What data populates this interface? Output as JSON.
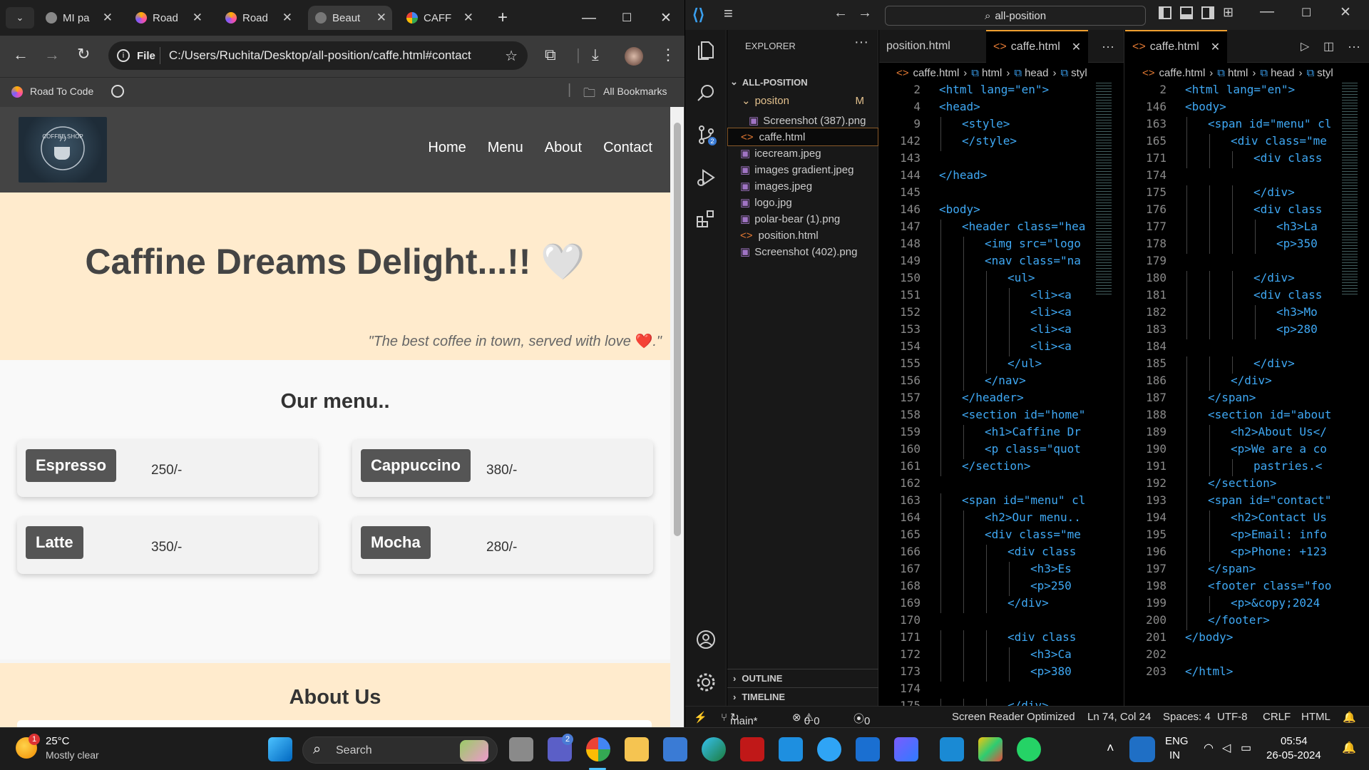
{
  "browser": {
    "tabs": [
      {
        "label": "MI pa"
      },
      {
        "label": "Road"
      },
      {
        "label": "Road"
      },
      {
        "label": "Beaut"
      },
      {
        "label": "CAFF"
      }
    ],
    "url": "C:/Users/Ruchita/Desktop/all-position/caffe.html#contact",
    "url_scheme_label": "File",
    "bookmarks": [
      {
        "label": "Road To Code"
      }
    ],
    "all_bookmarks": "All Bookmarks"
  },
  "site": {
    "nav": [
      "Home",
      "Menu",
      "About",
      "Contact"
    ],
    "hero_title": "Caffine Dreams Delight...!!",
    "heart": "🤍",
    "quote_a": "\"The best coffee in town, served with love ",
    "quote_heart": "❤️",
    "quote_b": ".\"",
    "menu_title": "Our menu..",
    "menu_items": [
      {
        "name": "Espresso",
        "price": "250/-"
      },
      {
        "name": "Cappuccino",
        "price": "380/-"
      },
      {
        "name": "Latte",
        "price": "350/-"
      },
      {
        "name": "Mocha",
        "price": "280/-"
      }
    ],
    "about_title": "About Us"
  },
  "vscode": {
    "search": "all-position",
    "explorer_title": "EXPLORER",
    "folder": "ALL-POSITION",
    "subfolder": "positon",
    "subfolder_badge": "M",
    "files": [
      "Screenshot (387).png",
      "caffe.html",
      "icecream.jpeg",
      "images gradient.jpeg",
      "images.jpeg",
      "logo.jpg",
      "polar-bear (1).png",
      "position.html",
      "Screenshot (402).png"
    ],
    "outline": "OUTLINE",
    "timeline": "TIMELINE",
    "editor1": {
      "tabs": [
        "position.html",
        "caffe.html"
      ],
      "crumbs": [
        "caffe.html",
        "html",
        "head",
        "styl"
      ],
      "lines": [
        {
          "n": "2",
          "t": "<html lang=\"en\">",
          "i": 0
        },
        {
          "n": "4",
          "t": "<head>",
          "i": 0
        },
        {
          "n": "9",
          "t": "<style>",
          "i": 1
        },
        {
          "n": "142",
          "t": "</style>",
          "i": 1
        },
        {
          "n": "143",
          "t": "",
          "i": 0
        },
        {
          "n": "144",
          "t": "</head>",
          "i": 0
        },
        {
          "n": "145",
          "t": "",
          "i": 0
        },
        {
          "n": "146",
          "t": "<body>",
          "i": 0
        },
        {
          "n": "147",
          "t": "<header class=\"hea",
          "i": 1
        },
        {
          "n": "148",
          "t": "<img src=\"logo",
          "i": 2
        },
        {
          "n": "149",
          "t": "<nav class=\"na",
          "i": 2
        },
        {
          "n": "150",
          "t": "<ul>",
          "i": 3
        },
        {
          "n": "151",
          "t": "<li><a",
          "i": 4
        },
        {
          "n": "152",
          "t": "<li><a",
          "i": 4
        },
        {
          "n": "153",
          "t": "<li><a",
          "i": 4
        },
        {
          "n": "154",
          "t": "<li><a",
          "i": 4
        },
        {
          "n": "155",
          "t": "</ul>",
          "i": 3
        },
        {
          "n": "156",
          "t": "</nav>",
          "i": 2
        },
        {
          "n": "157",
          "t": "</header>",
          "i": 1
        },
        {
          "n": "158",
          "t": "<section id=\"home\"",
          "i": 1
        },
        {
          "n": "159",
          "t": "<h1>Caffine Dr",
          "i": 2
        },
        {
          "n": "160",
          "t": "<p class=\"quot",
          "i": 2
        },
        {
          "n": "161",
          "t": "</section>",
          "i": 1
        },
        {
          "n": "162",
          "t": "",
          "i": 0
        },
        {
          "n": "163",
          "t": "<span id=\"menu\" cl",
          "i": 1
        },
        {
          "n": "164",
          "t": "<h2>Our menu..",
          "i": 2
        },
        {
          "n": "165",
          "t": "<div class=\"me",
          "i": 2
        },
        {
          "n": "166",
          "t": "<div class",
          "i": 3
        },
        {
          "n": "167",
          "t": "<h3>Es",
          "i": 4
        },
        {
          "n": "168",
          "t": "<p>250",
          "i": 4
        },
        {
          "n": "169",
          "t": "</div>",
          "i": 3
        },
        {
          "n": "170",
          "t": "",
          "i": 0
        },
        {
          "n": "171",
          "t": "<div class",
          "i": 3
        },
        {
          "n": "172",
          "t": "<h3>Ca",
          "i": 4
        },
        {
          "n": "173",
          "t": "<p>380",
          "i": 4
        },
        {
          "n": "174",
          "t": "",
          "i": 0
        },
        {
          "n": "175",
          "t": "</div>",
          "i": 3
        }
      ]
    },
    "editor2": {
      "tabs": [
        "caffe.html"
      ],
      "crumbs": [
        "caffe.html",
        "html",
        "head",
        "styl"
      ],
      "lines": [
        {
          "n": "2",
          "t": "<html lang=\"en\">",
          "i": 0
        },
        {
          "n": "146",
          "t": "<body>",
          "i": 0
        },
        {
          "n": "163",
          "t": "<span id=\"menu\" cl",
          "i": 1
        },
        {
          "n": "165",
          "t": "<div class=\"me",
          "i": 2
        },
        {
          "n": "171",
          "t": "<div class",
          "i": 3
        },
        {
          "n": "174",
          "t": "",
          "i": 0
        },
        {
          "n": "175",
          "t": "</div>",
          "i": 3
        },
        {
          "n": "176",
          "t": "<div class",
          "i": 3
        },
        {
          "n": "177",
          "t": "<h3>La",
          "i": 4
        },
        {
          "n": "178",
          "t": "<p>350",
          "i": 4
        },
        {
          "n": "179",
          "t": "",
          "i": 0
        },
        {
          "n": "180",
          "t": "</div>",
          "i": 3
        },
        {
          "n": "181",
          "t": "<div class",
          "i": 3
        },
        {
          "n": "182",
          "t": "<h3>Mo",
          "i": 4
        },
        {
          "n": "183",
          "t": "<p>280",
          "i": 4
        },
        {
          "n": "184",
          "t": "",
          "i": 0
        },
        {
          "n": "185",
          "t": "</div>",
          "i": 3
        },
        {
          "n": "186",
          "t": "</div>",
          "i": 2
        },
        {
          "n": "187",
          "t": "</span>",
          "i": 1
        },
        {
          "n": "188",
          "t": "<section id=\"about",
          "i": 1
        },
        {
          "n": "189",
          "t": "<h2>About Us</",
          "i": 2
        },
        {
          "n": "190",
          "t": "<p>We are a co",
          "i": 2
        },
        {
          "n": "191",
          "t": "pastries.<",
          "i": 3
        },
        {
          "n": "192",
          "t": "</section>",
          "i": 1
        },
        {
          "n": "193",
          "t": "<span id=\"contact\"",
          "i": 1
        },
        {
          "n": "194",
          "t": "<h2>Contact Us",
          "i": 2
        },
        {
          "n": "195",
          "t": "<p>Email: info",
          "i": 2
        },
        {
          "n": "196",
          "t": "<p>Phone: +123",
          "i": 2
        },
        {
          "n": "197",
          "t": "</span>",
          "i": 1
        },
        {
          "n": "198",
          "t": "<footer class=\"foo",
          "i": 1
        },
        {
          "n": "199",
          "t": "<p>&copy;2024",
          "i": 2
        },
        {
          "n": "200",
          "t": "</footer>",
          "i": 1
        },
        {
          "n": "201",
          "t": "</body>",
          "i": 0
        },
        {
          "n": "202",
          "t": "",
          "i": 0
        },
        {
          "n": "203",
          "t": "</html>",
          "i": 0
        }
      ]
    },
    "status": {
      "branch": "main*",
      "errors": "0",
      "warnings": "0",
      "ports": "0",
      "reader": "Screen Reader Optimized",
      "position": "Ln 74, Col 24",
      "spaces": "Spaces: 4",
      "encoding": "UTF-8",
      "eol": "CRLF",
      "language": "HTML"
    }
  },
  "taskbar": {
    "temp": "25°C",
    "weather": "Mostly clear",
    "weather_badge": "1",
    "search": "Search",
    "lang1": "ENG",
    "lang2": "IN",
    "time": "05:54",
    "date": "26-05-2024",
    "teams_badge": "2"
  }
}
